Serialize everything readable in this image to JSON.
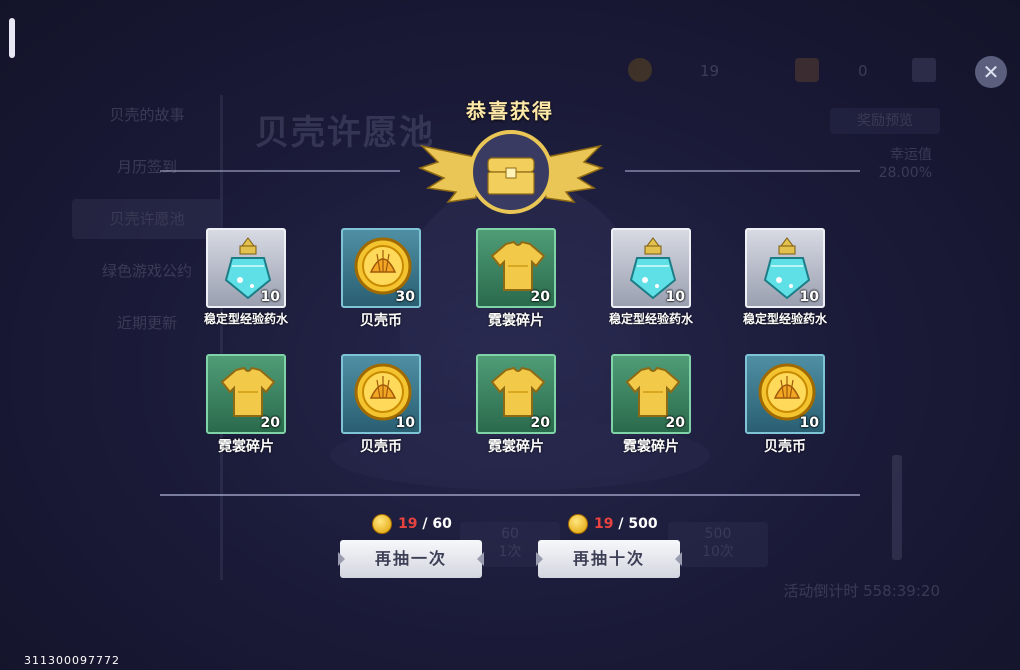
{
  "background": {
    "sidebar": [
      {
        "label": "贝壳的故事",
        "active": false
      },
      {
        "label": "月历签到",
        "active": false
      },
      {
        "label": "贝壳许愿池",
        "active": true
      },
      {
        "label": "绿色游戏公约",
        "active": false
      },
      {
        "label": "近期更新",
        "active": false
      }
    ],
    "title": "贝壳许愿池",
    "reward_preview": "奖励预览",
    "luck_label": "幸运值",
    "luck_value": "28.00%",
    "countdown": "活动倒计时  558:39:20",
    "currency_1": "19",
    "currency_2": "0",
    "bg_button_1": "60\n1次",
    "bg_button_2": "500\n10次"
  },
  "dialog": {
    "title": "恭喜获得",
    "items": [
      {
        "name": "稳定型经验药水",
        "count": "10",
        "type": "potion"
      },
      {
        "name": "贝壳币",
        "count": "30",
        "type": "coin"
      },
      {
        "name": "霓裳碎片",
        "count": "20",
        "type": "shirt"
      },
      {
        "name": "稳定型经验药水",
        "count": "10",
        "type": "potion"
      },
      {
        "name": "稳定型经验药水",
        "count": "10",
        "type": "potion"
      },
      {
        "name": "霓裳碎片",
        "count": "20",
        "type": "shirt"
      },
      {
        "name": "贝壳币",
        "count": "10",
        "type": "coin"
      },
      {
        "name": "霓裳碎片",
        "count": "20",
        "type": "shirt"
      },
      {
        "name": "霓裳碎片",
        "count": "20",
        "type": "shirt"
      },
      {
        "name": "贝壳币",
        "count": "10",
        "type": "coin"
      }
    ],
    "draw_once": {
      "label": "再抽一次",
      "have": "19",
      "cost": "60"
    },
    "draw_ten": {
      "label": "再抽十次",
      "have": "19",
      "cost": "500"
    }
  },
  "uid": "311300097772",
  "colors": {
    "accent_gold": "#ffe9a8",
    "shortfall_red": "#e8433f"
  }
}
